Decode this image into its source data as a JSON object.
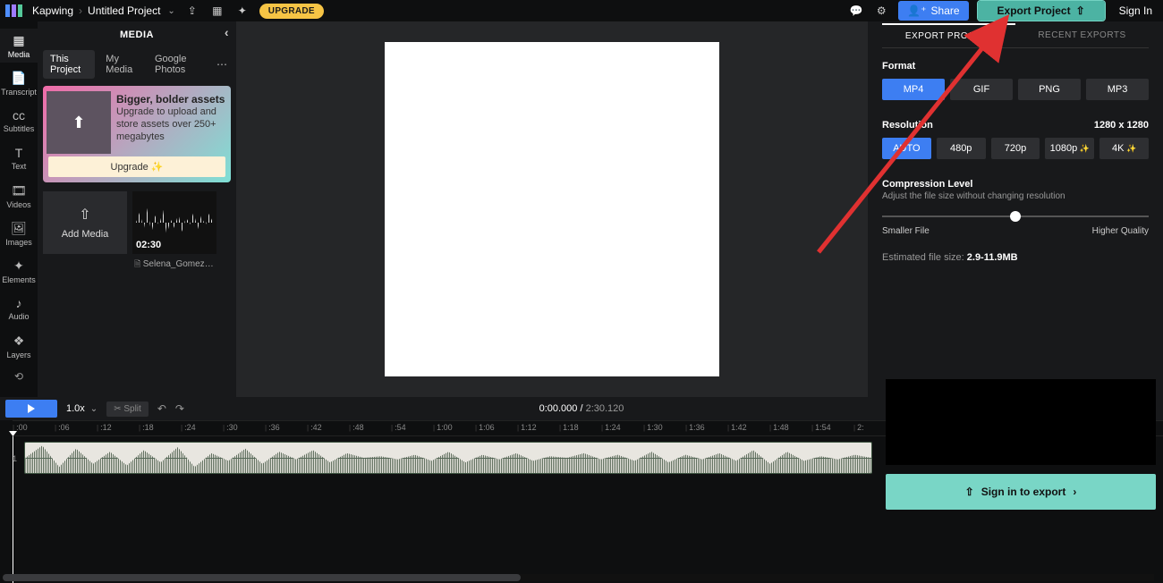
{
  "app": {
    "name": "Kapwing",
    "project": "Untitled Project"
  },
  "topbar": {
    "upgrade": "UPGRADE",
    "share": "Share",
    "export": "Export Project",
    "signin": "Sign In"
  },
  "rail": {
    "media": "Media",
    "transcript": "Transcript",
    "subtitles": "Subtitles",
    "text": "Text",
    "videos": "Videos",
    "images": "Images",
    "elements": "Elements",
    "audio": "Audio",
    "layers": "Layers"
  },
  "sidebar": {
    "title": "MEDIA",
    "tabs": {
      "this": "This Project",
      "my": "My Media",
      "google": "Google Photos"
    },
    "promo": {
      "title": "Bigger, bolder assets",
      "body": "Upgrade to upload and store assets over 250+ megabytes",
      "cta": "Upgrade ✨"
    },
    "addMedia": "Add Media",
    "asset": {
      "duration": "02:30",
      "name": "Selena_Gomez_-_…"
    }
  },
  "timeline": {
    "speed": "1.0x",
    "split": "✂ Split",
    "current": "0:00.000",
    "total": "2:30.120",
    "ticks": [
      ":00",
      ":06",
      ":12",
      ":18",
      ":24",
      ":30",
      ":36",
      ":42",
      ":48",
      ":54",
      "1:00",
      "1:06",
      "1:12",
      "1:18",
      "1:24",
      "1:30",
      "1:36",
      "1:42",
      "1:48",
      "1:54",
      "2:"
    ],
    "trackNum": "1"
  },
  "export": {
    "tabs": {
      "project": "EXPORT PROJECT",
      "recent": "RECENT EXPORTS"
    },
    "formatLabel": "Format",
    "formats": {
      "mp4": "MP4",
      "gif": "GIF",
      "png": "PNG",
      "mp3": "MP3"
    },
    "resLabel": "Resolution",
    "resValue": "1280 x 1280",
    "resOpts": {
      "auto": "AUTO",
      "480": "480p",
      "720": "720p",
      "1080": "1080p",
      "4k": "4K"
    },
    "compLabel": "Compression Level",
    "compSub": "Adjust the file size without changing resolution",
    "smaller": "Smaller File",
    "higher": "Higher Quality",
    "estLabel": "Estimated file size: ",
    "estValue": "2.9-11.9MB",
    "signinExport": "Sign in to export"
  }
}
